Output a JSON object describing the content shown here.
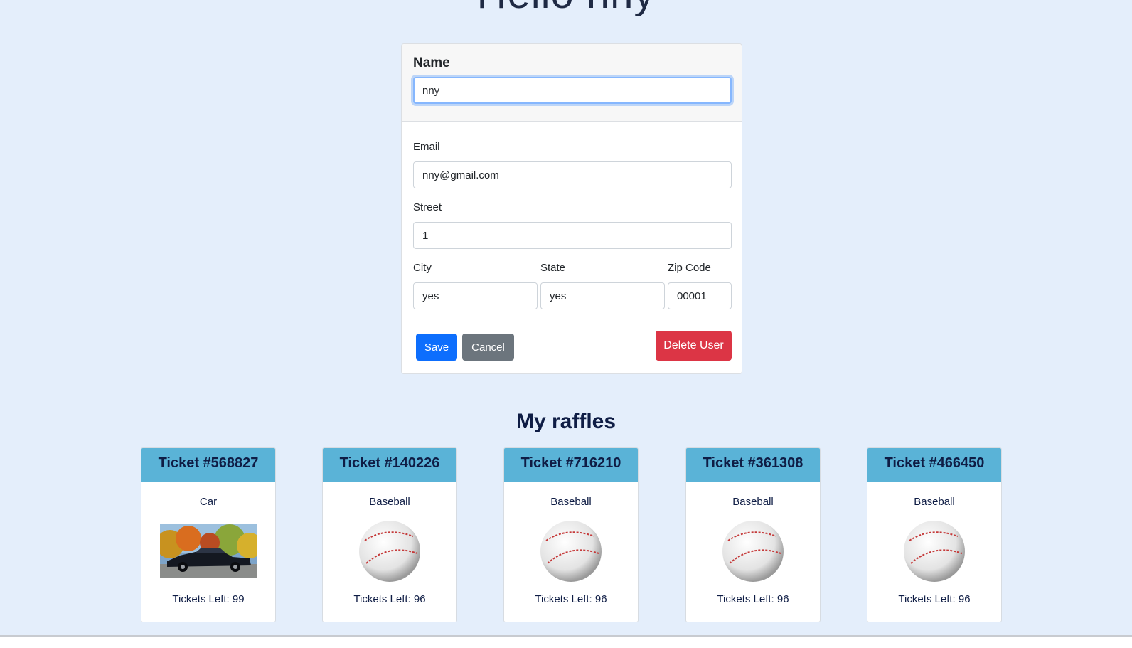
{
  "greeting": "Hello nny",
  "form": {
    "name_label": "Name",
    "name_value": "nny",
    "email_label": "Email",
    "email_value": "nny@gmail.com",
    "street_label": "Street",
    "street_value": "1",
    "city_label": "City",
    "city_value": "yes",
    "state_label": "State",
    "state_value": "yes",
    "zip_label": "Zip Code",
    "zip_value": "00001",
    "save_label": "Save",
    "cancel_label": "Cancel",
    "delete_label": "Delete User"
  },
  "raffles": {
    "title": "My raffles",
    "tickets": [
      {
        "header": "Ticket #568827",
        "item": "Car",
        "image": "car-image",
        "left": "Tickets Left: 99"
      },
      {
        "header": "Ticket #140226",
        "item": "Baseball",
        "image": "baseball-image",
        "left": "Tickets Left: 96"
      },
      {
        "header": "Ticket #716210",
        "item": "Baseball",
        "image": "baseball-image",
        "left": "Tickets Left: 96"
      },
      {
        "header": "Ticket #361308",
        "item": "Baseball",
        "image": "baseball-image",
        "left": "Tickets Left: 96"
      },
      {
        "header": "Ticket #466450",
        "item": "Baseball",
        "image": "baseball-image",
        "left": "Tickets Left: 96"
      }
    ]
  },
  "colors": {
    "background": "#e4eefb",
    "primary": "#0d6efd",
    "secondary": "#6c757d",
    "danger": "#dc3545",
    "ticket_header": "#5ab3d7",
    "title_text": "#0f1d45"
  }
}
